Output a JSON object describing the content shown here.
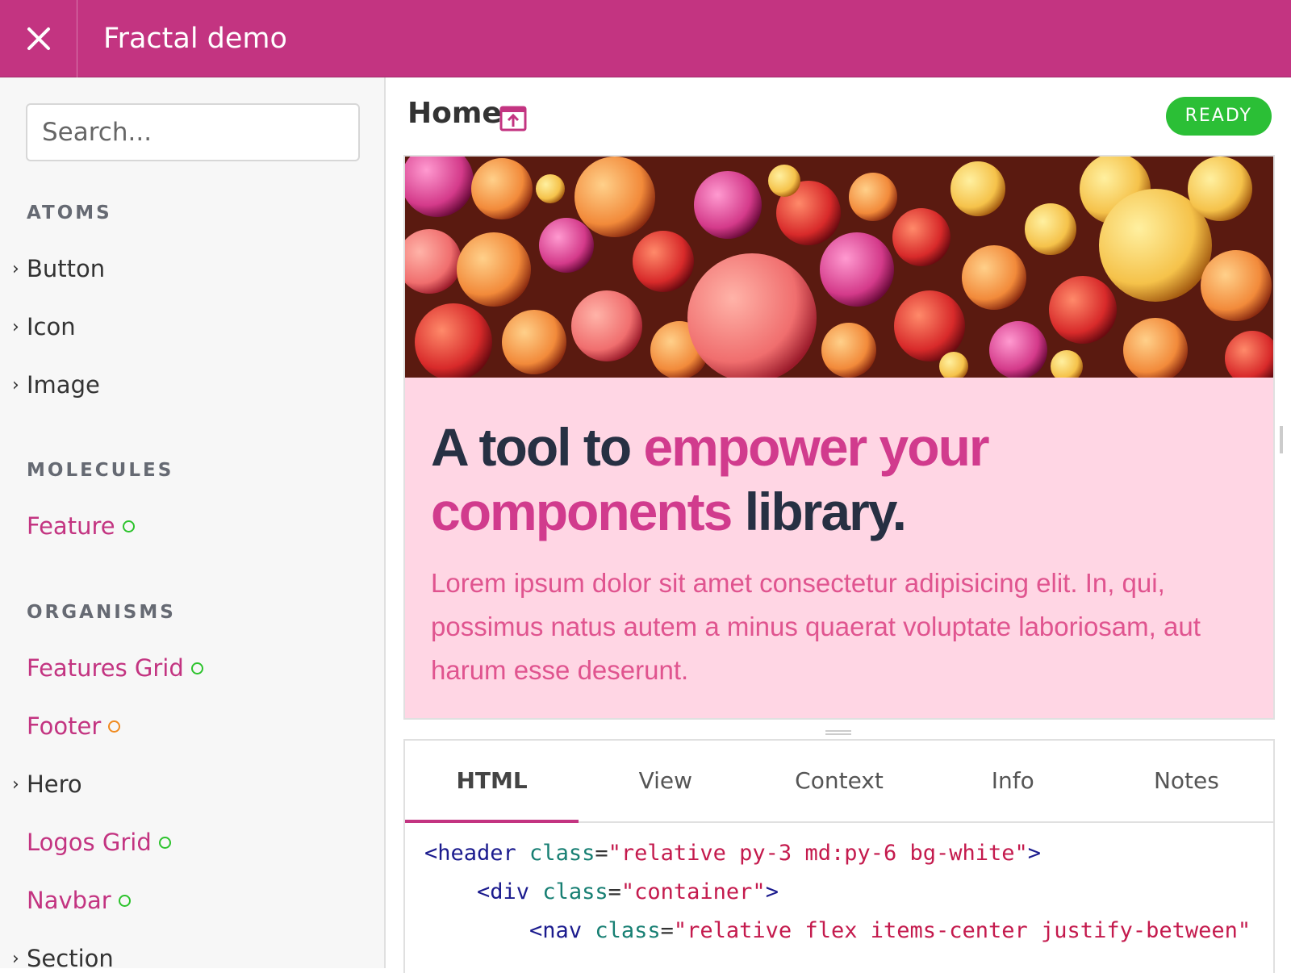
{
  "app": {
    "title": "Fractal demo"
  },
  "sidebar": {
    "search_placeholder": "Search...",
    "sections": [
      {
        "title": "ATOMS",
        "items": [
          {
            "label": "Button",
            "expandable": true
          },
          {
            "label": "Icon",
            "expandable": true
          },
          {
            "label": "Image",
            "expandable": true
          }
        ]
      },
      {
        "title": "MOLECULES",
        "items": [
          {
            "label": "Feature",
            "status": "green"
          }
        ]
      },
      {
        "title": "ORGANISMS",
        "items": [
          {
            "label": "Features Grid",
            "status": "green"
          },
          {
            "label": "Footer",
            "status": "orange"
          },
          {
            "label": "Hero",
            "expandable": true
          },
          {
            "label": "Logos Grid",
            "status": "green"
          },
          {
            "label": "Navbar",
            "status": "green"
          },
          {
            "label": "Section",
            "expandable": true
          }
        ]
      }
    ]
  },
  "main": {
    "page_title": "Home",
    "status_badge": "READY",
    "preview": {
      "heading_part1": "A tool to ",
      "heading_highlight": "empower your components",
      "heading_part2": " library.",
      "body": "Lorem ipsum dolor sit amet consectetur adipisicing elit. In, qui, possimus natus autem a minus quaerat voluptate laboriosam, aut harum esse deserunt."
    },
    "tabs": [
      "HTML",
      "View",
      "Context",
      "Info",
      "Notes"
    ],
    "active_tab": "HTML",
    "code_lines": [
      {
        "indent": "",
        "tag": "<header",
        "attr": " class",
        "eq": "=",
        "value": "\"relative py-3 md:py-6 bg-white\"",
        "end": ">"
      },
      {
        "indent": "    ",
        "tag": "<div",
        "attr": " class",
        "eq": "=",
        "value": "\"container\"",
        "end": ">"
      },
      {
        "indent": "        ",
        "tag": "<nav",
        "attr": " class",
        "eq": "=",
        "value": "\"relative flex items-center justify-between\"",
        "end": ""
      }
    ]
  },
  "colors": {
    "brand": "#c33481",
    "ready": "#2bbf36",
    "status_green": "#2cc32c",
    "status_orange": "#f08a1f"
  }
}
